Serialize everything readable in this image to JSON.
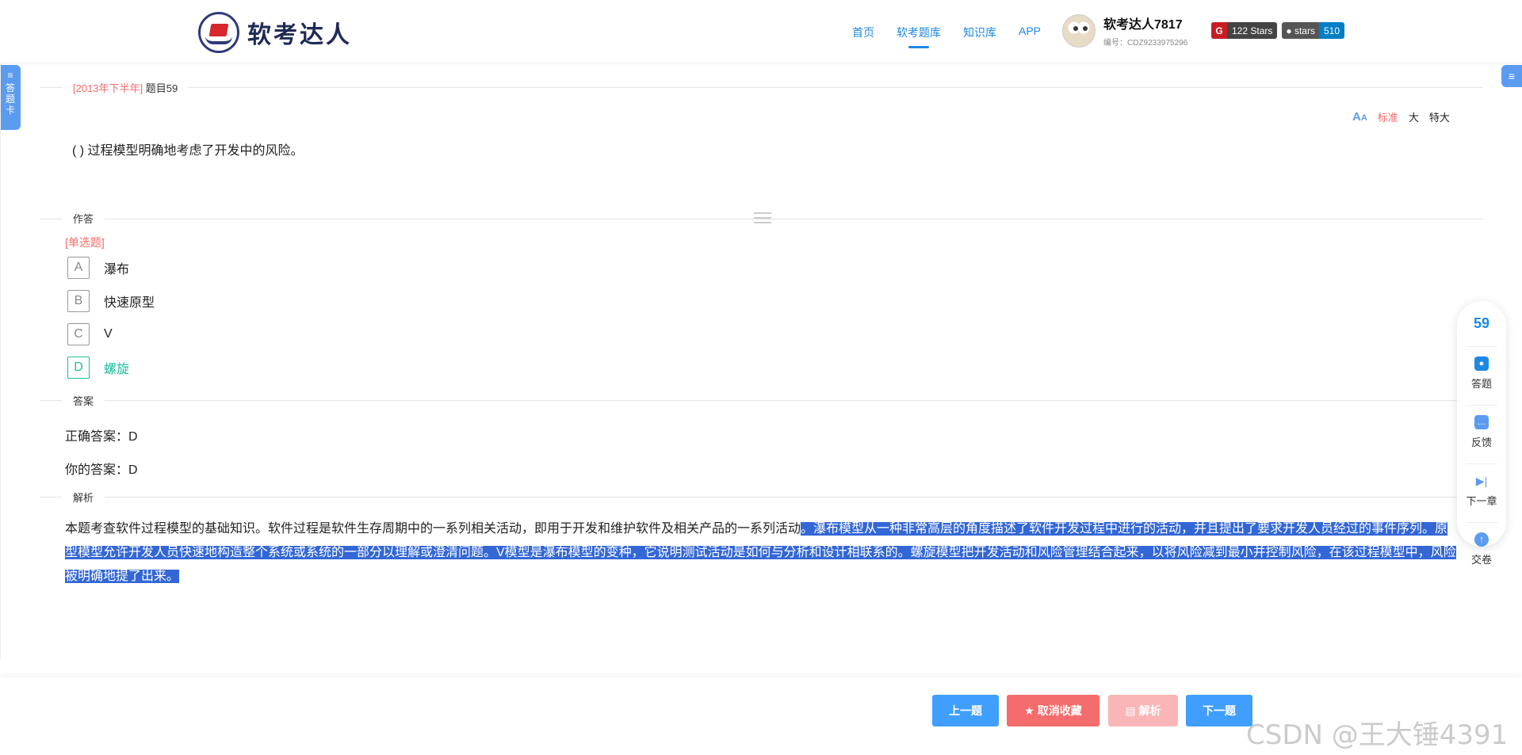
{
  "header": {
    "logo_text": "软考达人",
    "nav": [
      "首页",
      "软考题库",
      "知识库",
      "APP"
    ],
    "user_name": "软考达人7817",
    "user_id": "编号：CDZ9233975296",
    "gitee_badge": "122 Stars",
    "github_label": "stars",
    "github_count": "510"
  },
  "side": {
    "left_tab": "答题卡",
    "left_icon": "≡",
    "right_icon": "≡"
  },
  "question": {
    "year_tag": "[2013年下半年]",
    "number": "题目59",
    "text": "( ) 过程模型明确地考虑了开发中的风险。",
    "font_sizes": [
      "标准",
      "大",
      "特大"
    ],
    "type": "[单选题]",
    "options": [
      {
        "letter": "A",
        "text": "瀑布"
      },
      {
        "letter": "B",
        "text": "快速原型"
      },
      {
        "letter": "C",
        "text": "V"
      },
      {
        "letter": "D",
        "text": "螺旋"
      }
    ],
    "selected": "D"
  },
  "sections": {
    "answer_section": "作答",
    "result_section": "答案",
    "analysis_section": "解析"
  },
  "answer": {
    "correct": "正确答案：D",
    "yours": "你的答案：D"
  },
  "analysis": {
    "plain": "本题考查软件过程模型的基础知识。软件过程是软件生存周期中的一系列相关活动，即用于开发和维护软件及相关产品的一系列活动",
    "highlighted": "。瀑布模型从一种非常高层的角度描述了软件开发过程中进行的活动，并且提出了要求开发人员经过的事件序列。原型模型允许开发人员快速地构造整个系统或系统的一部分以理解或澄清问题。V模型是瀑布模型的变种，它说明测试活动是如何与分析和设计相联系的。螺旋模型把开发活动和风险管理结合起来，以将风险减到最小并控制风险，在该过程模型中，风险被明确地提了出来。"
  },
  "float_panel": {
    "number": "59",
    "items": [
      "答题",
      "反馈",
      "下一章",
      "交卷"
    ]
  },
  "bottom": {
    "prev": "上一题",
    "favorite": "★ 取消收藏",
    "analysis": "▤ 解析",
    "next": "下一题"
  },
  "watermark": "CSDN @王大锤4391"
}
